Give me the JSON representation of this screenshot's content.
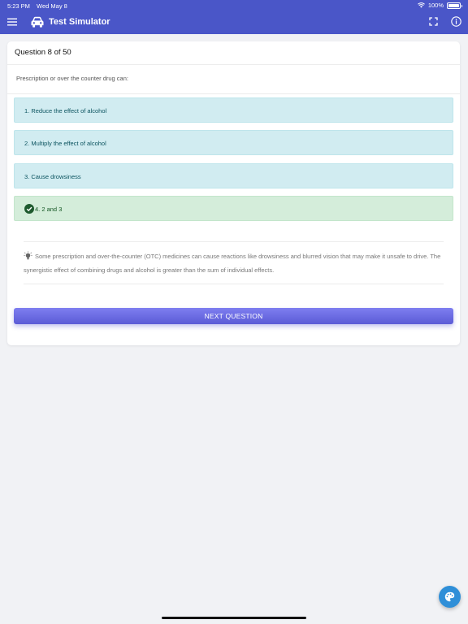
{
  "status": {
    "time": "5:23 PM",
    "date": "Wed May 8",
    "battery": "100%",
    "wifi_icon": "wifi-icon"
  },
  "header": {
    "title": "Test Simulator",
    "menu_icon": "hamburger-menu-icon",
    "logo_icon": "car-icon",
    "fullscreen_icon": "fullscreen-icon",
    "info_icon": "info-icon",
    "color": "#4a56c8"
  },
  "question": {
    "counter": "Question 8 of 50",
    "text": "Prescription or over the counter drug can:",
    "options": [
      {
        "label": "1. Reduce the effect of alcohol",
        "state": "neutral"
      },
      {
        "label": "2. Multiply the effect of alcohol",
        "state": "neutral"
      },
      {
        "label": "3. Cause drowsiness",
        "state": "neutral"
      },
      {
        "label": "4. 2 and 3",
        "state": "correct"
      }
    ],
    "explanation": "Some prescription and over-the-counter (OTC) medicines can cause reactions like drowsiness and blurred vision that may make it unsafe to drive. The synergistic effect of combining drugs and alcohol is greater than the sum of individual effects.",
    "explanation_icon": "lightbulb-icon"
  },
  "actions": {
    "next_label": "NEXT QUESTION",
    "palette_icon": "palette-icon"
  },
  "colors": {
    "option_bg": "#d1ecf1",
    "correct_bg": "#d4edda",
    "button": "#6b6be3",
    "fab": "#2f8fd8"
  }
}
